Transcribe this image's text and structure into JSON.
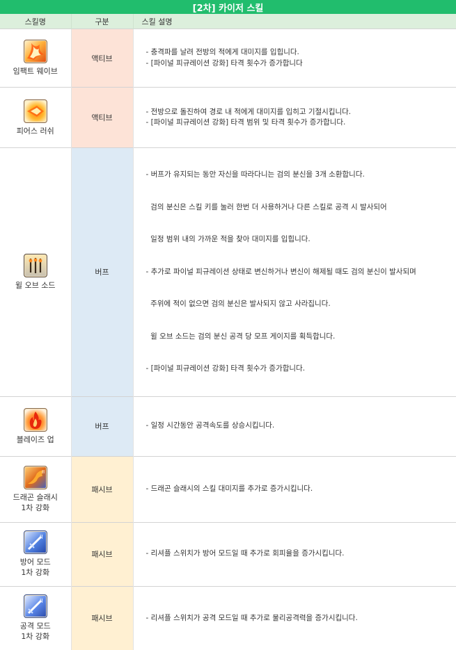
{
  "title": "[2차] 카이저 스킬",
  "headers": {
    "skill": "스킬명",
    "type": "구분",
    "desc": "스킬 설명"
  },
  "rows": [
    {
      "name": "임팩트 웨이브",
      "sub": "",
      "icon": "impact-wave-icon",
      "type": "액티브",
      "kind": "active",
      "desc": [
        "- 충격파를 날려 전방의 적에게 대미지를 입힙니다.",
        "- [파이널 피규레이션 강화] 타격 횟수가 증가합니다"
      ]
    },
    {
      "name": "피어스 러쉬",
      "sub": "",
      "icon": "pierce-rush-icon",
      "type": "액티브",
      "kind": "active",
      "desc": [
        "- 전방으로 돌진하여 경로 내 적에게 대미지를 입히고 기절시킵니다.",
        "- [파이널 피규레이션 강화] 타격 범위 및 타격 횟수가 증가합니다."
      ]
    },
    {
      "name": "윌 오브 소드",
      "sub": "",
      "icon": "will-of-sword-icon",
      "type": "버프",
      "kind": "buff",
      "desc": [
        "- 버프가 유지되는 동안 자신을 따라다니는 검의 분신을 3개 소환합니다.",
        "  검의 분신은 스킬 키를 눌러 한번 더 사용하거나 다른 스킬로 공격 시 발사되어",
        "  일정 범위 내의 가까운 적을 찾아 대미지를 입힙니다.",
        "- 추가로 파이널 피규레이션 상태로 변신하거나 변신이 해제될 때도 검의 분신이 발사되며",
        "  주위에 적이 없으면 검의 분신은 발사되지 않고 사라집니다.",
        "  윌 오브 소드는 검의 분신 공격 당 모프 게이지를 획득합니다.",
        "- [파이널 피규레이션 강화] 타격 횟수가 증가합니다."
      ]
    },
    {
      "name": "블레이즈 업",
      "sub": "",
      "icon": "blaze-up-icon",
      "type": "버프",
      "kind": "buff",
      "desc": [
        "- 일정 시간동안 공격속도를 상승시킵니다."
      ]
    },
    {
      "name": "드래곤 슬래시",
      "sub": "1차 강화",
      "icon": "dragon-slash-icon",
      "type": "패시브",
      "kind": "passive",
      "desc": [
        "- 드래곤 슬래시의 스킬 대미지를 추가로 증가시킵니다."
      ]
    },
    {
      "name": "방어 모드",
      "sub": "1차 강화",
      "icon": "defense-mode-icon",
      "type": "패시브",
      "kind": "passive",
      "desc": [
        "- 리셔플 스위치가 방어 모드일 때 추가로 회피율을 증가시킵니다."
      ]
    },
    {
      "name": "공격 모드",
      "sub": "1차 강화",
      "icon": "attack-mode-icon",
      "type": "패시브",
      "kind": "passive",
      "desc": [
        "- 리셔플 스위치가 공격 모드일 때 추가로 물리공격력을 증가시킵니다."
      ]
    }
  ]
}
